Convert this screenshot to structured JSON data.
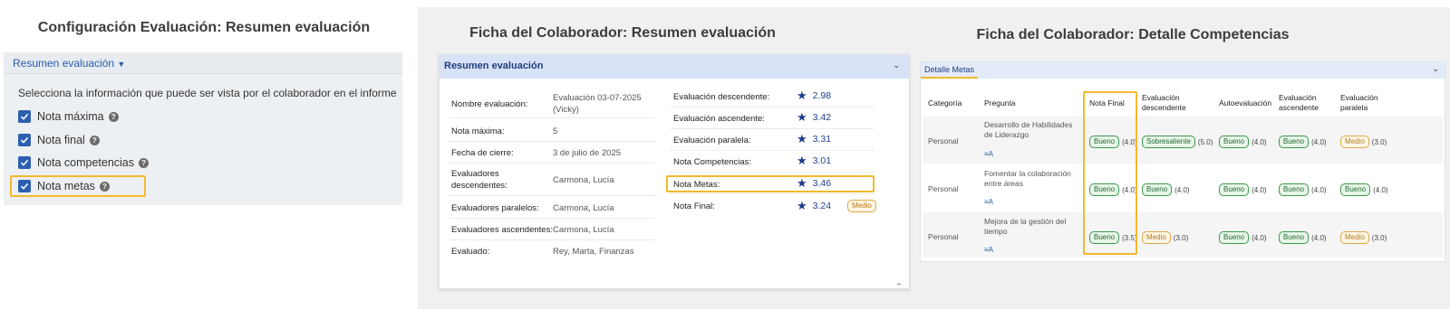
{
  "panel1": {
    "title": "Configuración Evaluación: Resumen evaluación",
    "header_label": "Resumen evaluación",
    "description": "Selecciona la información que puede ser vista por el colaborador en el informe",
    "options": [
      {
        "label": "Nota máxima",
        "checked": true
      },
      {
        "label": "Nota final",
        "checked": true
      },
      {
        "label": "Nota competencias",
        "checked": true
      },
      {
        "label": "Nota metas",
        "checked": true
      }
    ]
  },
  "panel2": {
    "title": "Ficha del Colaborador: Resumen evaluación",
    "card_title": "Resumen evaluación",
    "info": [
      {
        "label": "Nombre evaluación:",
        "value": "Evaluación 03-07-2025 (Vicky)"
      },
      {
        "label": "Nota máxima:",
        "value": "5"
      },
      {
        "label": "Fecha de cierre:",
        "value": "3 de julio de 2025"
      },
      {
        "label": "Evaluadores descendentes:",
        "value": "Carmona, Lucía"
      },
      {
        "label": "Evaluadores paralelos:",
        "value": "Carmona, Lucía"
      },
      {
        "label": "Evaluadores ascendentes:",
        "value": "Carmona, Lucía"
      },
      {
        "label": "Evaluado:",
        "value": "Rey, Marta, Finanzas"
      }
    ],
    "scores": [
      {
        "label": "Evaluación descendente:",
        "value": "2.98"
      },
      {
        "label": "Evaluación ascendente:",
        "value": "3.42"
      },
      {
        "label": "Evaluación paralela:",
        "value": "3.31"
      },
      {
        "label": "Nota Competencias:",
        "value": "3.01"
      },
      {
        "label": "Nota Metas:",
        "value": "3.46"
      },
      {
        "label": "Nota Final:",
        "value": "3.24",
        "badge": "Medio"
      }
    ]
  },
  "panel3": {
    "title": "Ficha del Colaborador: Detalle Competencias",
    "card_title": "Detalle Metas",
    "columns": [
      "Categoría",
      "Pregunta",
      "Nota Final",
      "Evaluación descendente",
      "Autoevaluación",
      "Evaluación ascendente",
      "Evaluación paralela"
    ],
    "rows": [
      {
        "category": "Personal",
        "question": "Desarrollo de Habilidades de Liderazgo",
        "cells": [
          {
            "badge": "Bueno",
            "score": "(4.0)"
          },
          {
            "badge": "Sobresaliente",
            "score": "(5.0)"
          },
          {
            "badge": "Bueno",
            "score": "(4.0)"
          },
          {
            "badge": "Bueno",
            "score": "(4.0)"
          },
          {
            "badge": "Medio",
            "score": "(3.0)"
          }
        ]
      },
      {
        "category": "Personal",
        "question": "Fomentar la colaboración entre áreas",
        "cells": [
          {
            "badge": "Bueno",
            "score": "(4.0)"
          },
          {
            "badge": "Bueno",
            "score": "(4.0)"
          },
          {
            "badge": "Bueno",
            "score": "(4.0)"
          },
          {
            "badge": "Bueno",
            "score": "(4.0)"
          },
          {
            "badge": "Bueno",
            "score": "(4.0)"
          }
        ]
      },
      {
        "category": "Personal",
        "question": "Mejora de la gestión del tiempo",
        "cells": [
          {
            "badge": "Bueno",
            "score": "(3.5)"
          },
          {
            "badge": "Medio",
            "score": "(3.0)"
          },
          {
            "badge": "Bueno",
            "score": "(4.0)"
          },
          {
            "badge": "Bueno",
            "score": "(4.0)"
          },
          {
            "badge": "Medio",
            "score": "(3.0)"
          }
        ]
      }
    ]
  },
  "colors": {
    "highlight": "#f2b92c",
    "accent_blue": "#2d5fb1",
    "badge_green": "#3c9a4e",
    "badge_orange": "#e0a64a"
  }
}
